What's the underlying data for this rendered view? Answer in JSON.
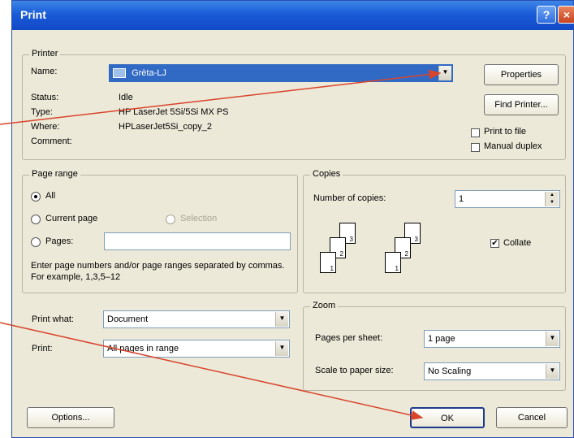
{
  "window": {
    "title": "Print"
  },
  "printer": {
    "legend": "Printer",
    "name_label": "Name:",
    "name_value": "Grèta-LJ",
    "status_label": "Status:",
    "status_value": "Idle",
    "type_label": "Type:",
    "type_value": "HP LaserJet 5Si/5Si MX PS",
    "where_label": "Where:",
    "where_value": "HPLaserJet5Si_copy_2",
    "comment_label": "Comment:",
    "properties_label": "Properties",
    "find_printer_label": "Find Printer...",
    "print_to_file_label": "Print to file",
    "manual_duplex_label": "Manual duplex"
  },
  "page_range": {
    "legend": "Page range",
    "all_label": "All",
    "current_label": "Current page",
    "selection_label": "Selection",
    "pages_label": "Pages:",
    "hint": "Enter page numbers and/or page ranges separated by commas.  For example, 1,3,5–12"
  },
  "copies": {
    "legend": "Copies",
    "number_label": "Number of copies:",
    "number_value": "1",
    "collate_label": "Collate"
  },
  "print_what": {
    "label": "Print what:",
    "value": "Document"
  },
  "print_sel": {
    "label": "Print:",
    "value": "All pages in range"
  },
  "zoom": {
    "legend": "Zoom",
    "pps_label": "Pages per sheet:",
    "pps_value": "1 page",
    "scale_label": "Scale to paper size:",
    "scale_value": "No Scaling"
  },
  "buttons": {
    "options": "Options...",
    "ok": "OK",
    "cancel": "Cancel"
  },
  "icons": {
    "help": "?",
    "close": "×",
    "dropdown": "▼",
    "spin_up": "▲",
    "spin_down": "▼",
    "check": "✔"
  },
  "colors": {
    "title_bar": "#1a5bd8",
    "selection": "#316ac5",
    "annotation_arrow": "#d9442b"
  }
}
